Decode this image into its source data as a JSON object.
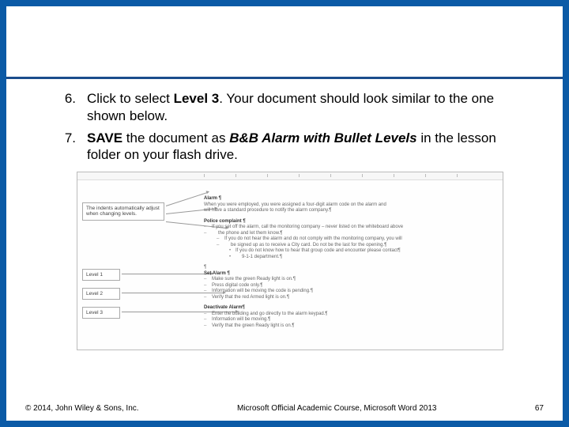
{
  "steps": [
    {
      "num": "6.",
      "pre": "Click to select ",
      "bold1": "Level 3",
      "post1": ". Your document should look similar to the one shown below."
    },
    {
      "num": "7.",
      "pre": " ",
      "bold1": "SAVE",
      "mid": " the document as ",
      "bi": "B&B Alarm with Bullet Levels",
      "post1": " in the lesson folder on your flash drive."
    }
  ],
  "figure": {
    "callouts": {
      "indent": "The indents automatically adjust when changing levels.",
      "l1": "Level 1",
      "l2": "Level 2",
      "l3": "Level 3"
    },
    "doc": {
      "title": "Alarm ¶",
      "intro1": "When you were employed, you were assigned a four-digit alarm code on the alarm and",
      "intro2": "will have a standard procedure to notify the alarm company.¶",
      "subTitle": "Police complaint ¶",
      "b1a": "If you set off the alarm, call the monitoring company – never listed on the whiteboard above",
      "b1b": "the phone and let them know.¶",
      "b2a": "If you do not hear the alarm and do not comply with the monitoring company, you will",
      "b2b": "be signed up as to receive a City card. Do not be the last for the opening.¶",
      "b3": "If you do not know how to hear that group code and encounter please contact¶",
      "b3b": "9-1-1 department.¶",
      "sec2Title": "Set Alarm ¶",
      "s2l1": "Make sure the green Ready light is on.¶",
      "s2l2": "Press digital code only.¶",
      "s2l3": "Information will be moving the code is pending.¶",
      "s2l4": "Verify that the red Armed light is on.¶",
      "sec3Title": "Deactivate Alarm¶",
      "s3l1": "Enter the building and go directly to the alarm keypad.¶",
      "s3l2": "Information will be moving.¶",
      "s3l3": "Verify that the green Ready light is on.¶"
    }
  },
  "footer": {
    "left": "© 2014, John Wiley & Sons, Inc.",
    "center": "Microsoft Official Academic Course, Microsoft Word 2013",
    "right": "67"
  }
}
